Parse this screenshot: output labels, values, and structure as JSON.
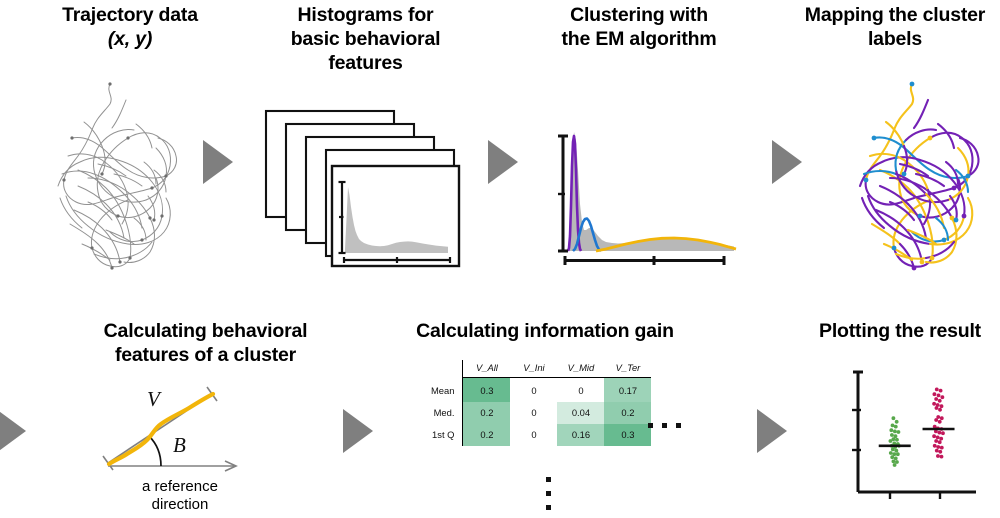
{
  "figure": {
    "kind": "workflow-diagram",
    "caption_font_color": "#000000",
    "arrow_color": "#7f7f7f"
  },
  "steps": {
    "top": [
      {
        "id": "trajectory",
        "line1": "Trajectory  data",
        "line2": "(x, y)"
      },
      {
        "id": "histograms",
        "line1": "Histograms for",
        "line2": "basic behavioral",
        "line3": "features"
      },
      {
        "id": "clustering",
        "line1": "Clustering with",
        "line2": "the EM algorithm"
      },
      {
        "id": "mapping",
        "line1": "Mapping the cluster",
        "line2": "labels"
      }
    ],
    "bottom": [
      {
        "id": "features",
        "line1": "Calculating behavioral",
        "line2": "features of a cluster"
      },
      {
        "id": "infogain",
        "line1": "Calculating information gain"
      },
      {
        "id": "plotting",
        "line1": "Plotting the result"
      }
    ]
  },
  "feature_diagram": {
    "velocity_label": "V",
    "angle_label": "B",
    "reference_caption_line1": "a reference",
    "reference_caption_line2": "direction",
    "path_color": "#f2b50a",
    "guide_color": "#808080"
  },
  "info_gain_table": {
    "columns": [
      "V_All",
      "V_Ini",
      "V_Mid",
      "V_Ter"
    ],
    "row_labels": [
      "Mean",
      "Med.",
      "1st Q"
    ],
    "rows": [
      {
        "label": "Mean",
        "values": [
          "0.3",
          "0",
          "0",
          "0.17"
        ],
        "numeric": [
          0.3,
          0,
          0,
          0.17
        ]
      },
      {
        "label": "Med.",
        "values": [
          "0.2",
          "0",
          "0.04",
          "0.2"
        ],
        "numeric": [
          0.2,
          0,
          0.04,
          0.2
        ]
      },
      {
        "label": "1st Q",
        "values": [
          "0.2",
          "0",
          "0.16",
          "0.3"
        ],
        "numeric": [
          0.2,
          0,
          0.16,
          0.3
        ]
      }
    ],
    "heat_color": "#4caf7d",
    "ellipsis_horizontal": "•••",
    "ellipsis_vertical": "⋮"
  },
  "chart_data": [
    {
      "id": "histogram-card",
      "type": "bar",
      "title": "",
      "xlabel": "",
      "ylabel": "",
      "grid": false,
      "legend": "none",
      "series_color": "#b3b3b3",
      "values": [
        4,
        66,
        100,
        92,
        70,
        52,
        40,
        31,
        25,
        21,
        18,
        16,
        14,
        13,
        12,
        11,
        11,
        10,
        10,
        10,
        10,
        10,
        10,
        11,
        11,
        12,
        13,
        14,
        15,
        16,
        17,
        17,
        18,
        18,
        18,
        17,
        17,
        16,
        16,
        15,
        15,
        14,
        14,
        13,
        13,
        12,
        12,
        12,
        11,
        11,
        10,
        10,
        9,
        9,
        8,
        8,
        7,
        7,
        6,
        6
      ],
      "ylim": [
        0,
        100
      ]
    },
    {
      "id": "em-mixture",
      "type": "area",
      "title": "",
      "xlabel": "",
      "ylabel": "",
      "grid": false,
      "legend": "none",
      "histogram_color": "#b8b8b8",
      "components": [
        {
          "name": "component-1",
          "color": "#7321b5",
          "mean": 0.055,
          "sd": 0.016,
          "peak": 0.93
        },
        {
          "name": "component-2",
          "color": "#1f77d0",
          "mean": 0.135,
          "sd": 0.03,
          "peak": 0.23
        },
        {
          "name": "component-3",
          "color": "#f2b50a",
          "mean": 0.6,
          "sd": 0.24,
          "peak": 0.14
        }
      ],
      "histogram_values": [
        5,
        55,
        97,
        85,
        55,
        30,
        18,
        14,
        13,
        13,
        13,
        14,
        14,
        14,
        13,
        12,
        11,
        10,
        10,
        10,
        10,
        10,
        10,
        10,
        11,
        11,
        12,
        12,
        13,
        13,
        13,
        14,
        14,
        14,
        14,
        14,
        14,
        14,
        13,
        13,
        13,
        12,
        12,
        12,
        11,
        11,
        11,
        10,
        10,
        10,
        10,
        9,
        9,
        9,
        8,
        8,
        8,
        7,
        7,
        7
      ],
      "ylim": [
        0,
        1
      ]
    },
    {
      "id": "result-strip-plot",
      "type": "scatter",
      "title": "",
      "xlabel": "",
      "ylabel": "",
      "grid": false,
      "legend": "none",
      "xlim": [
        0,
        2
      ],
      "ylim": [
        0,
        1
      ],
      "y_ticks": [
        0.38,
        0.72
      ],
      "x_ticks": [
        0.62,
        1.35
      ],
      "groups": [
        {
          "name": "group-1",
          "color": "#58a84c",
          "mean_line": 0.385,
          "points": [
            [
              0.6,
              0.615
            ],
            [
              0.655,
              0.585
            ],
            [
              0.585,
              0.555
            ],
            [
              0.64,
              0.545
            ],
            [
              0.565,
              0.515
            ],
            [
              0.625,
              0.505
            ],
            [
              0.685,
              0.5
            ],
            [
              0.575,
              0.475
            ],
            [
              0.635,
              0.465
            ],
            [
              0.6,
              0.44
            ],
            [
              0.66,
              0.435
            ],
            [
              0.55,
              0.425
            ],
            [
              0.615,
              0.405
            ],
            [
              0.675,
              0.4
            ],
            [
              0.57,
              0.385
            ],
            [
              0.63,
              0.375
            ],
            [
              0.695,
              0.385
            ],
            [
              0.59,
              0.355
            ],
            [
              0.65,
              0.345
            ],
            [
              0.555,
              0.325
            ],
            [
              0.615,
              0.315
            ],
            [
              0.675,
              0.315
            ],
            [
              0.58,
              0.29
            ],
            [
              0.64,
              0.28
            ],
            [
              0.6,
              0.255
            ],
            [
              0.66,
              0.25
            ],
            [
              0.62,
              0.225
            ]
          ]
        },
        {
          "name": "group-2",
          "color": "#c2185b",
          "mean_line": 0.525,
          "points": [
            [
              1.335,
              0.855
            ],
            [
              1.4,
              0.845
            ],
            [
              1.295,
              0.815
            ],
            [
              1.365,
              0.805
            ],
            [
              1.43,
              0.79
            ],
            [
              1.325,
              0.775
            ],
            [
              1.385,
              0.76
            ],
            [
              1.29,
              0.735
            ],
            [
              1.35,
              0.725
            ],
            [
              1.415,
              0.715
            ],
            [
              1.33,
              0.7
            ],
            [
              1.39,
              0.685
            ],
            [
              1.36,
              0.625
            ],
            [
              1.42,
              0.615
            ],
            [
              1.325,
              0.6
            ],
            [
              1.385,
              0.585
            ],
            [
              1.3,
              0.545
            ],
            [
              1.355,
              0.53
            ],
            [
              1.415,
              0.525
            ],
            [
              1.32,
              0.505
            ],
            [
              1.38,
              0.495
            ],
            [
              1.44,
              0.49
            ],
            [
              1.29,
              0.465
            ],
            [
              1.35,
              0.455
            ],
            [
              1.41,
              0.445
            ],
            [
              1.325,
              0.425
            ],
            [
              1.385,
              0.415
            ],
            [
              1.3,
              0.385
            ],
            [
              1.36,
              0.375
            ],
            [
              1.42,
              0.37
            ],
            [
              1.335,
              0.345
            ],
            [
              1.395,
              0.335
            ],
            [
              1.355,
              0.3
            ],
            [
              1.415,
              0.295
            ]
          ]
        }
      ]
    }
  ],
  "trajectory_plots": {
    "raw": {
      "id": "raw-trajectory",
      "color": "#8c8c8c"
    },
    "labeled": {
      "id": "labeled-trajectory",
      "cluster_colors": [
        "#7321b5",
        "#f5c21b",
        "#1f8ecf"
      ]
    }
  }
}
